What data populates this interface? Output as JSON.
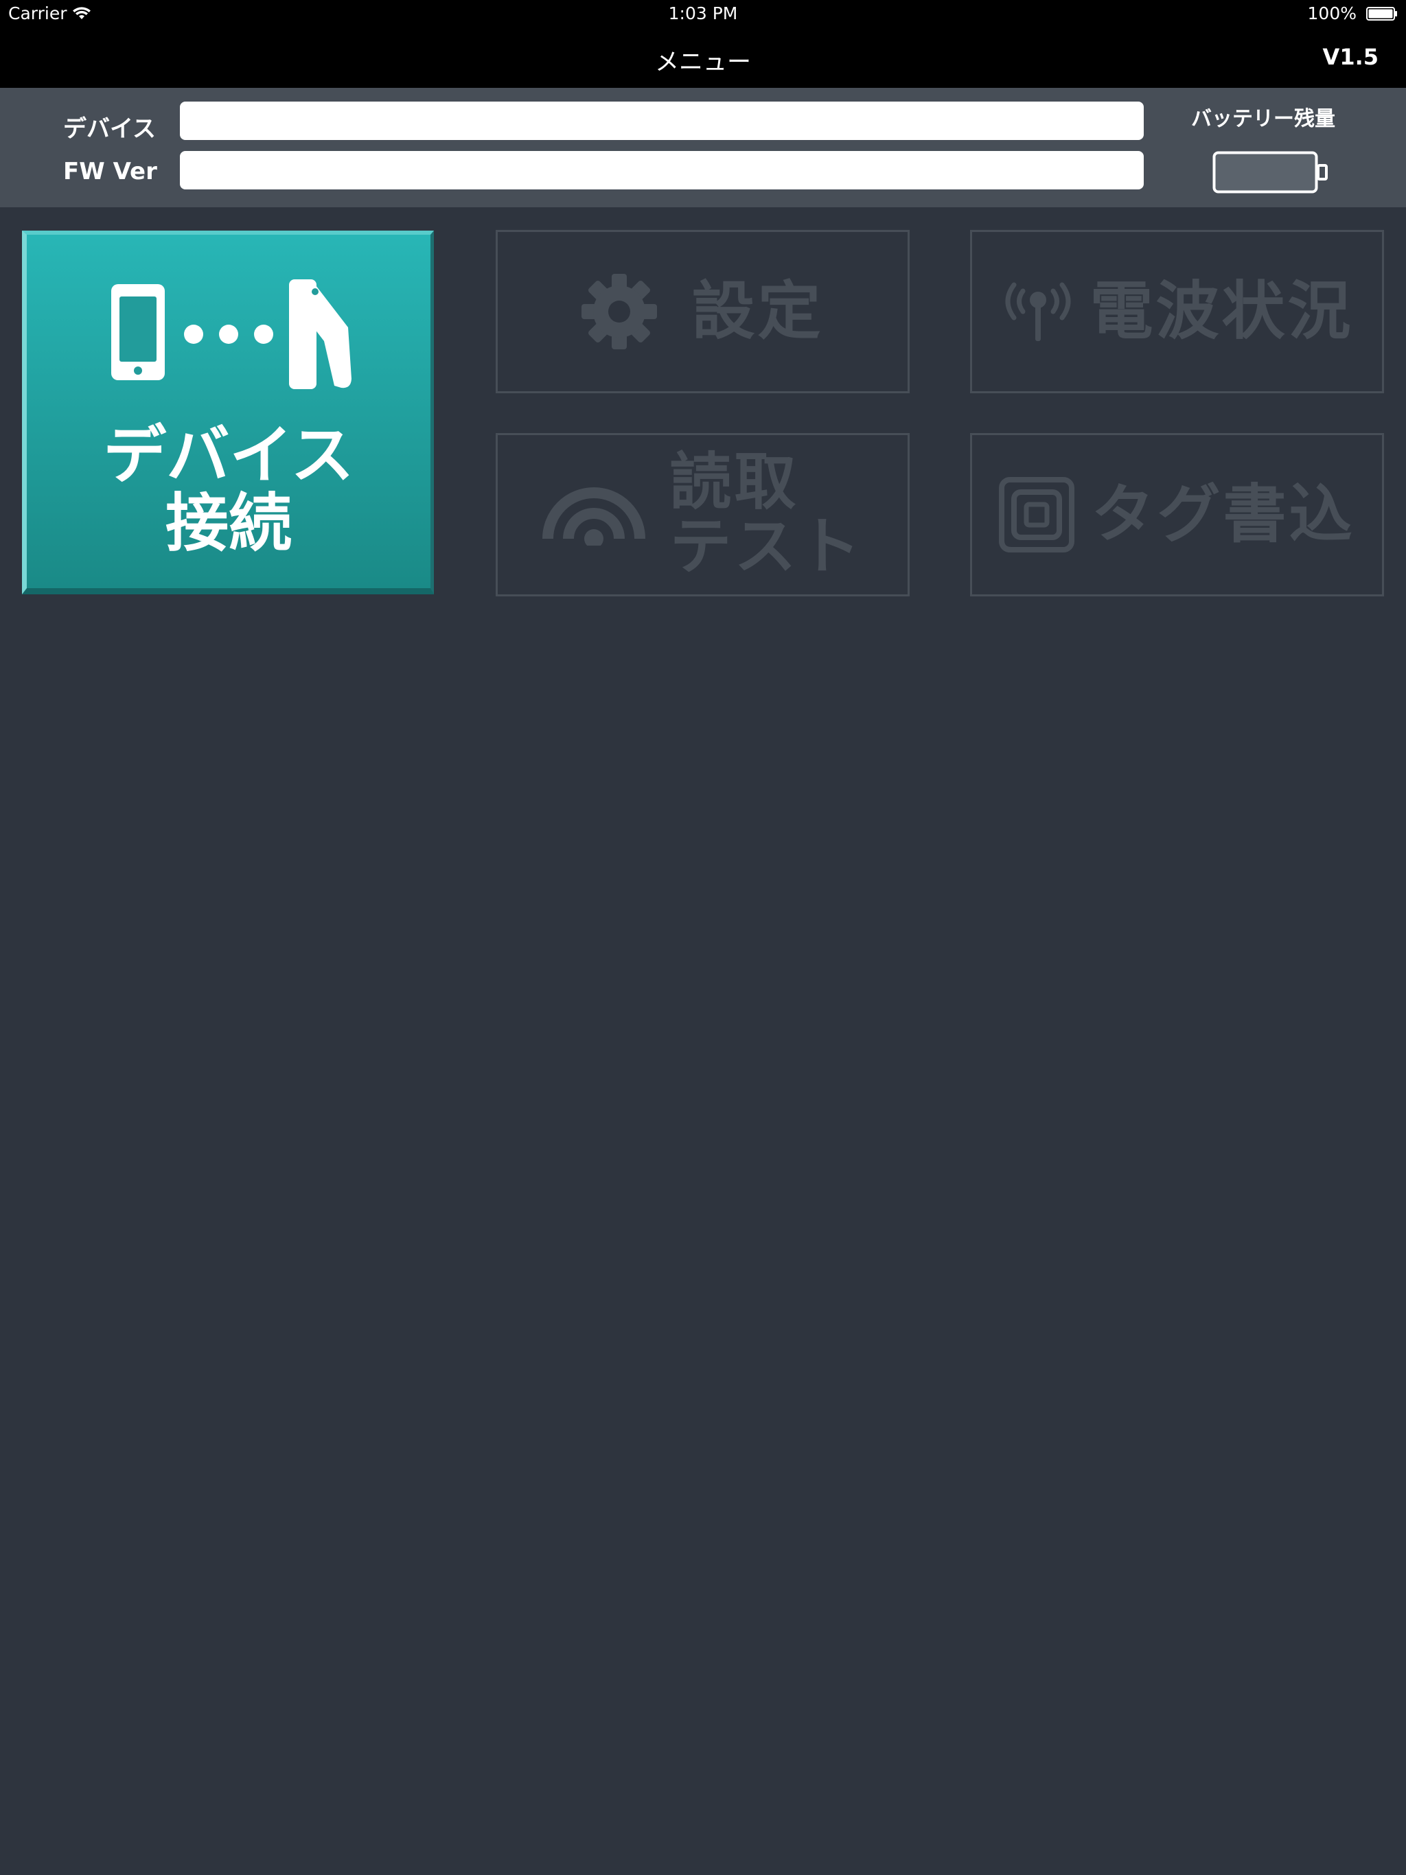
{
  "status_bar": {
    "carrier": "Carrier",
    "time": "1:03 PM",
    "battery_percent": "100%"
  },
  "nav": {
    "title": "メニュー",
    "version": "V1.5"
  },
  "info": {
    "device_label": "デバイス",
    "device_value": "",
    "fw_label": "FW Ver",
    "fw_value": "",
    "battery_label": "バッテリー残量"
  },
  "tiles": {
    "connect": "デバイス\n接続",
    "settings": "設定",
    "signal": "電波状況",
    "read_test": "読取\nテスト",
    "tag_write": "タグ書込"
  },
  "colors": {
    "background": "#2e343e",
    "panel": "#474e57",
    "accent_teal": "#22a9a8",
    "disabled": "#474e57"
  },
  "icons": {
    "connect": "phone-to-reader-icon",
    "settings": "gear-icon",
    "signal": "antenna-icon",
    "read_test": "rfid-read-icon",
    "tag_write": "tag-icon"
  }
}
